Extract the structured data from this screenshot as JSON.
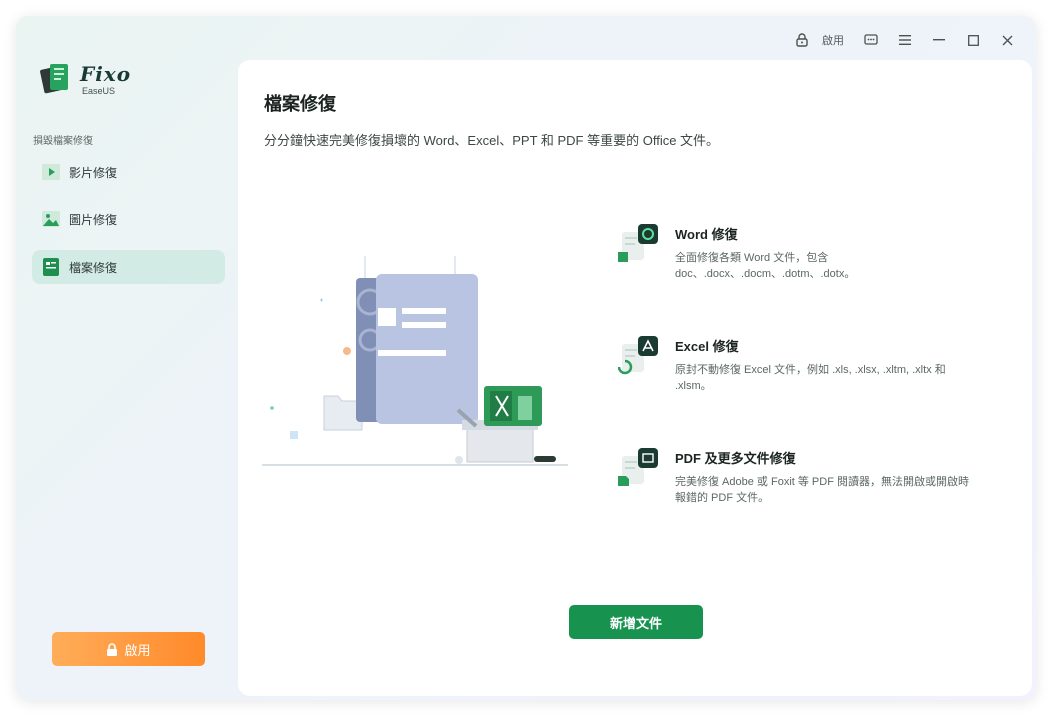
{
  "app": {
    "name": "Fixo",
    "subtitle": "EaseUS"
  },
  "titlebar": {
    "activate_label": "啟用",
    "icons": [
      "lock-icon",
      "feedback-icon",
      "menu-icon",
      "minimize-icon",
      "maximize-icon",
      "close-icon"
    ]
  },
  "sidebar": {
    "section_label": "損毀檔案修復",
    "items": [
      {
        "label": "影片修復",
        "icon": "video-icon",
        "active": false
      },
      {
        "label": "圖片修復",
        "icon": "image-icon",
        "active": false
      },
      {
        "label": "檔案修復",
        "icon": "document-icon",
        "active": true
      }
    ],
    "activate_button": "啟用"
  },
  "main": {
    "title": "檔案修復",
    "description": "分分鐘快速完美修復損壞的 Word、Excel、PPT 和 PDF 等重要的 Office 文件。",
    "features": [
      {
        "title": "Word 修復",
        "desc_line1": "全面修復各類 Word 文件，包含",
        "desc_line2": "doc、.docx、.docm、.dotm、.dotx。",
        "icon": "word-repair-icon"
      },
      {
        "title": "Excel 修復",
        "desc_line1": "原封不動修復 Excel 文件，例如 .xls, .xlsx, .xltm, .xltx 和",
        "desc_line2": ".xlsm。",
        "icon": "excel-repair-icon"
      },
      {
        "title": "PDF 及更多文件修復",
        "desc_line1": "完美修復 Adobe 或 Foxit 等 PDF 閱讀器，無法開啟或開啟時",
        "desc_line2": "報錯的 PDF 文件。",
        "icon": "pdf-repair-icon"
      }
    ],
    "add_button": "新增文件"
  },
  "colors": {
    "accent_green": "#17924f",
    "activate_orange": "#ff8a2a",
    "active_nav_bg": "#d3ebe5"
  }
}
